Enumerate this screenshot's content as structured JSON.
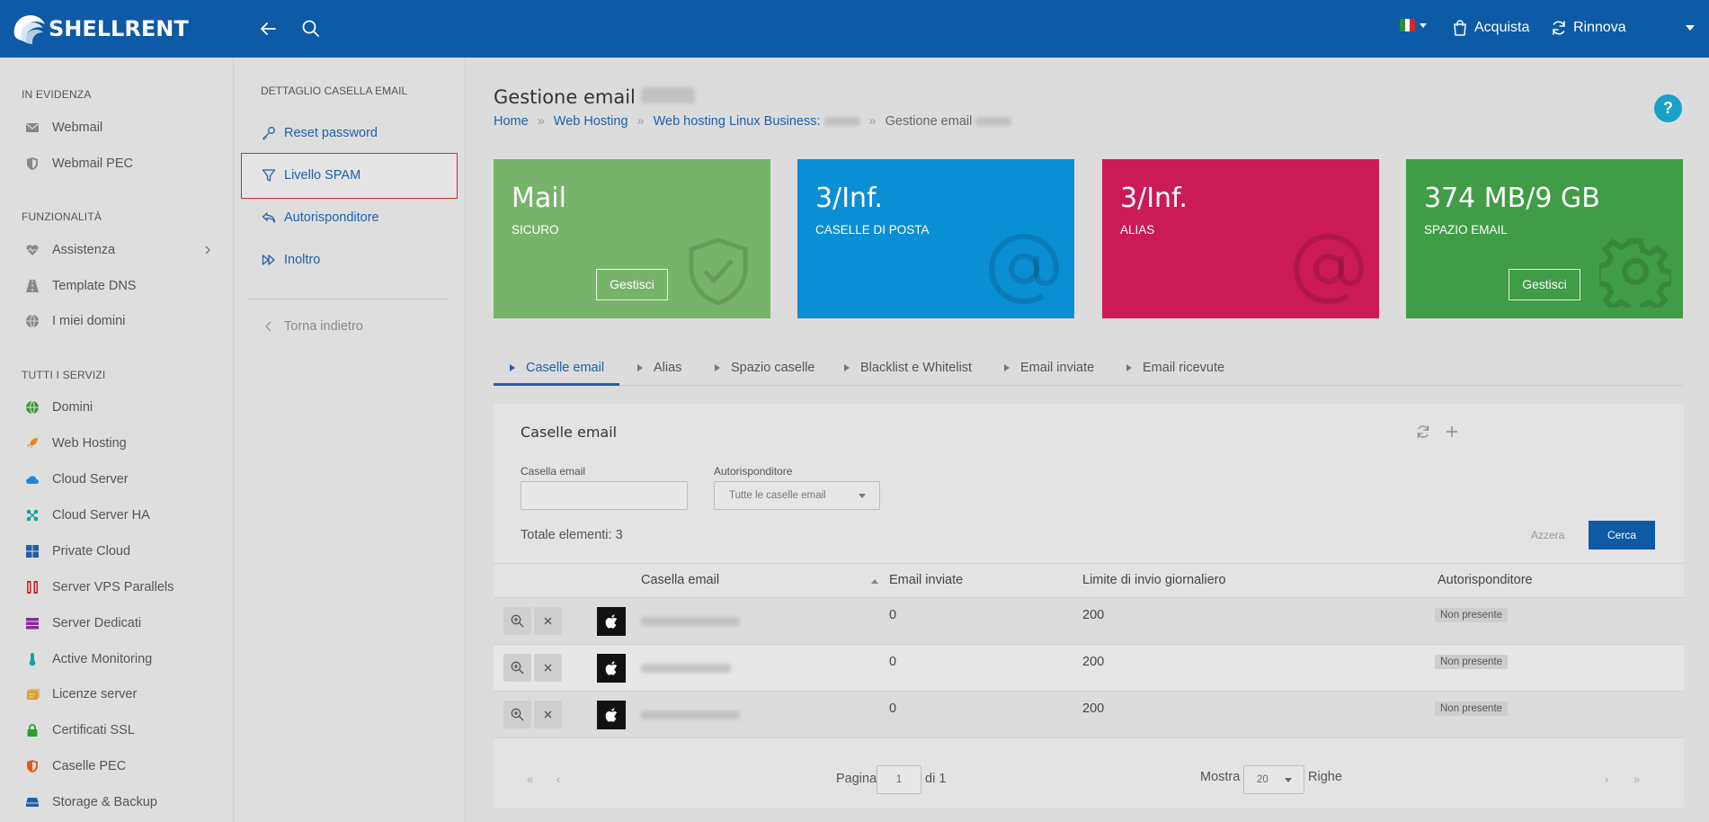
{
  "app": {
    "brand": "SHELLRENT",
    "brand_color": "#0d5aa6"
  },
  "topbar": {
    "acquista": "Acquista",
    "rinnova": "Rinnova",
    "flag_colors": [
      "#2d8a3f",
      "#ffffff",
      "#d12b2b"
    ]
  },
  "sidebar": {
    "sections": [
      {
        "title": "IN EVIDENZA",
        "items": [
          {
            "label": "Webmail",
            "icon": "envelope-icon"
          },
          {
            "label": "Webmail PEC",
            "icon": "shield-icon"
          }
        ]
      },
      {
        "title": "FUNZIONALITÀ",
        "items": [
          {
            "label": "Assistenza",
            "icon": "heart-pulse-icon"
          },
          {
            "label": "Template DNS",
            "icon": "road-icon"
          },
          {
            "label": "I miei domini",
            "icon": "globe-icon"
          }
        ]
      },
      {
        "title": "TUTTI I SERVIZI",
        "items": [
          {
            "label": "Domini",
            "icon": "globe-icon",
            "color": "#3a9a3a"
          },
          {
            "label": "Web Hosting",
            "icon": "rocket-icon",
            "color": "#e08a1e"
          },
          {
            "label": "Cloud Server",
            "icon": "cloud-icon",
            "color": "#1e88d8"
          },
          {
            "label": "Cloud Server HA",
            "icon": "cluster-icon",
            "color": "#19a0a0"
          },
          {
            "label": "Private Cloud",
            "icon": "grid-icon",
            "color": "#1e5fa8"
          },
          {
            "label": "Server VPS Parallels",
            "icon": "parallels-icon",
            "color": "#d02020"
          },
          {
            "label": "Server Dedicati",
            "icon": "server-icon",
            "color": "#8a2a9a"
          },
          {
            "label": "Active Monitoring",
            "icon": "thermometer-icon",
            "color": "#19a0a0"
          },
          {
            "label": "Licenze server",
            "icon": "license-icon",
            "color": "#e0a020"
          },
          {
            "label": "Certificati SSL",
            "icon": "lock-icon",
            "color": "#2aa02a"
          },
          {
            "label": "Caselle PEC",
            "icon": "shield-icon",
            "color": "#e05a1a"
          },
          {
            "label": "Storage & Backup",
            "icon": "storage-icon",
            "color": "#1e5fa8"
          }
        ]
      }
    ]
  },
  "subnav": {
    "title": "DETTAGLIO CASELLA EMAIL",
    "items": [
      {
        "label": "Reset password",
        "icon": "key-icon"
      },
      {
        "label": "Livello SPAM",
        "icon": "filter-icon"
      },
      {
        "label": "Autorisponditore",
        "icon": "reply-icon"
      },
      {
        "label": "Inoltro",
        "icon": "forward-icon"
      }
    ],
    "back": "Torna indietro"
  },
  "main": {
    "title": "Gestione email",
    "breadcrumb": [
      "Home",
      "Web Hosting",
      "Web hosting Linux Business:",
      "Gestione email"
    ],
    "cards": [
      {
        "value": "Mail",
        "label": "SICURO",
        "button": "Gestisci",
        "color": "#77b36a"
      },
      {
        "value": "3/Inf.",
        "label": "CASELLE DI POSTA",
        "color": "#0a8ed4"
      },
      {
        "value": "3/Inf.",
        "label": "ALIAS",
        "color": "#cc1a57"
      },
      {
        "value": "374 MB/9 GB",
        "label": "SPAZIO EMAIL",
        "button": "Gestisci",
        "color": "#409c47"
      }
    ],
    "tabs": [
      "Caselle email",
      "Alias",
      "Spazio caselle",
      "Blacklist e Whitelist",
      "Email inviate",
      "Email ricevute"
    ],
    "panel": {
      "title": "Caselle email",
      "filter_email_label": "Casella email",
      "filter_email_value": "",
      "filter_auto_label": "Autorisponditore",
      "filter_auto_value": "Tutte le caselle email",
      "total": "Totale elementi: 3",
      "azzera": "Azzera",
      "cerca": "Cerca",
      "columns": [
        "Casella email",
        "Email inviate",
        "Limite di invio giornaliero",
        "Autorisponditore"
      ],
      "rows": [
        {
          "sent": "0",
          "limit": "200",
          "auto": "Non presente"
        },
        {
          "sent": "0",
          "limit": "200",
          "auto": "Non presente"
        },
        {
          "sent": "0",
          "limit": "200",
          "auto": "Non presente"
        }
      ],
      "pager": {
        "pagina": "Pagina",
        "page": "1",
        "di": "di 1",
        "mostra": "Mostra",
        "per_page": "20",
        "righe": "Righe",
        "first": "«",
        "prev": "‹",
        "next": "›",
        "last": "»"
      }
    }
  }
}
